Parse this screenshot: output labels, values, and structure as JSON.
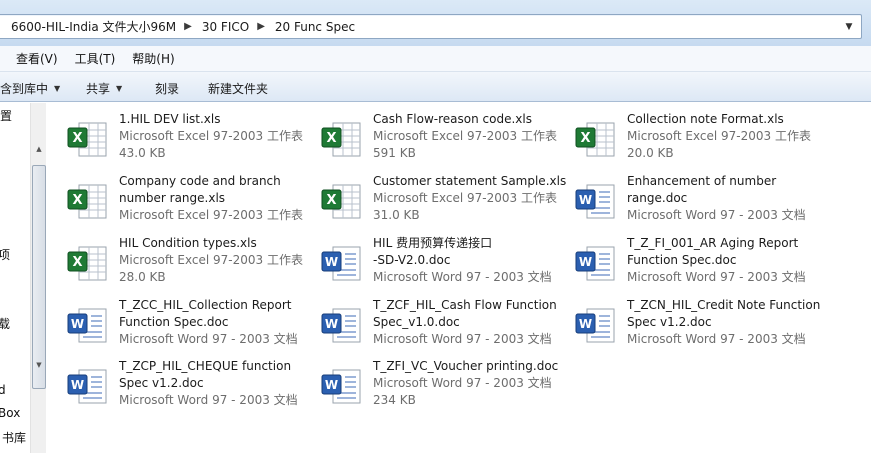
{
  "address": {
    "crumbs": [
      "6600-HIL-India 文件大小96M",
      "30 FICO",
      "20 Func Spec"
    ]
  },
  "menu": [
    "查看(V)",
    "工具(T)",
    "帮助(H)"
  ],
  "toolbar": {
    "include_label": "包含到库中",
    "share_label": "共享",
    "burn_label": "刻录",
    "new_folder_label": "新建文件夹"
  },
  "nav": {
    "items": [
      "位置",
      "项",
      "载",
      "d",
      "Box",
      "书库"
    ]
  },
  "colors": {
    "excel_green": "#1f7a35",
    "word_blue": "#2b5fb0"
  },
  "files": [
    {
      "name": "1.HIL DEV list.xls",
      "type": "Microsoft Excel 97-2003 工作表",
      "size": "43.0 KB",
      "icon": "excel-icon"
    },
    {
      "name": "Cash Flow-reason code.xls",
      "type": "Microsoft Excel 97-2003 工作表",
      "size": "591 KB",
      "icon": "excel-icon"
    },
    {
      "name": "Collection note Format.xls",
      "type": "Microsoft Excel 97-2003 工作表",
      "size": "20.0 KB",
      "icon": "excel-icon"
    },
    {
      "name": "Company code and branch\nnumber range.xls",
      "type": "Microsoft Excel 97-2003 工作表",
      "size": "",
      "icon": "excel-icon"
    },
    {
      "name": "Customer statement Sample.xls",
      "type": "Microsoft Excel 97-2003 工作表",
      "size": "31.0 KB",
      "icon": "excel-icon"
    },
    {
      "name": "Enhancement of number\nrange.doc",
      "type": "Microsoft Word 97 - 2003 文档",
      "size": "",
      "icon": "word-icon"
    },
    {
      "name": "HIL Condition types.xls",
      "type": "Microsoft Excel 97-2003 工作表",
      "size": "28.0 KB",
      "icon": "excel-icon"
    },
    {
      "name": "HIL 费用预算传递接口\n-SD-V2.0.doc",
      "type": "Microsoft Word 97 - 2003 文档",
      "size": "",
      "icon": "word-icon"
    },
    {
      "name": "T_Z_FI_001_AR Aging Report\nFunction Spec.doc",
      "type": "Microsoft Word 97 - 2003 文档",
      "size": "",
      "icon": "word-icon"
    },
    {
      "name": "T_ZCC_HIL_Collection Report\nFunction Spec.doc",
      "type": "Microsoft Word 97 - 2003 文档",
      "size": "",
      "icon": "word-icon"
    },
    {
      "name": "T_ZCF_HIL_Cash Flow Function\nSpec_v1.0.doc",
      "type": "Microsoft Word 97 - 2003 文档",
      "size": "",
      "icon": "word-icon"
    },
    {
      "name": "T_ZCN_HIL_Credit Note Function\nSpec v1.2.doc",
      "type": "Microsoft Word 97 - 2003 文档",
      "size": "",
      "icon": "word-icon"
    },
    {
      "name": "T_ZCP_HIL_CHEQUE function\nSpec v1.2.doc",
      "type": "Microsoft Word 97 - 2003 文档",
      "size": "",
      "icon": "word-icon"
    },
    {
      "name": "T_ZFI_VC_Voucher printing.doc",
      "type": "Microsoft Word 97 - 2003 文档",
      "size": "234 KB",
      "icon": "word-icon"
    }
  ]
}
